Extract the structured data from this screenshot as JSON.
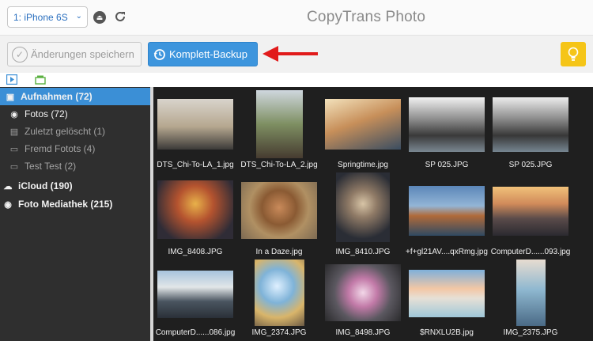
{
  "toolbar": {
    "device": "1: iPhone 6S",
    "app_title": "CopyTrans Photo",
    "save_label": "Änderungen speichern",
    "backup_label": "Komplett-Backup"
  },
  "sidebar": {
    "items": [
      {
        "label": "Aufnahmen (72)",
        "icon": "camera-roll-icon"
      },
      {
        "label": "Fotos (72)",
        "icon": "camera-icon"
      },
      {
        "label": "Zuletzt gelöscht (1)",
        "icon": "trash-icon"
      },
      {
        "label": "Fremd Fotots (4)",
        "icon": "album-icon"
      },
      {
        "label": "Test Test (2)",
        "icon": "album-icon"
      },
      {
        "label": "iCloud (190)",
        "icon": "cloud-icon"
      },
      {
        "label": "Foto Mediathek (215)",
        "icon": "camera-icon"
      }
    ]
  },
  "photos": [
    {
      "caption": "DTS_Chi-To-LA_1.jpg"
    },
    {
      "caption": "DTS_Chi-To-LA_2.jpg"
    },
    {
      "caption": "Springtime.jpg"
    },
    {
      "caption": "SP 025.JPG"
    },
    {
      "caption": "SP 025.JPG"
    },
    {
      "caption": "IMG_8408.JPG"
    },
    {
      "caption": "In a Daze.jpg"
    },
    {
      "caption": "IMG_8410.JPG"
    },
    {
      "caption": "+f+gl21AV....qxRmg.jpg"
    },
    {
      "caption": "ComputerD......093.jpg"
    },
    {
      "caption": "ComputerD......086.jpg"
    },
    {
      "caption": "IMG_2374.JPG"
    },
    {
      "caption": "IMG_8498.JPG"
    },
    {
      "caption": "$RNXLU2B.jpg"
    },
    {
      "caption": "IMG_2375.JPG"
    }
  ],
  "colors": {
    "accent": "#3b8fd6",
    "sidebar_bg": "#2f2f2f",
    "grid_bg": "#1f1f1f",
    "arrow": "#e11b1b",
    "bulb": "#f5c518"
  }
}
